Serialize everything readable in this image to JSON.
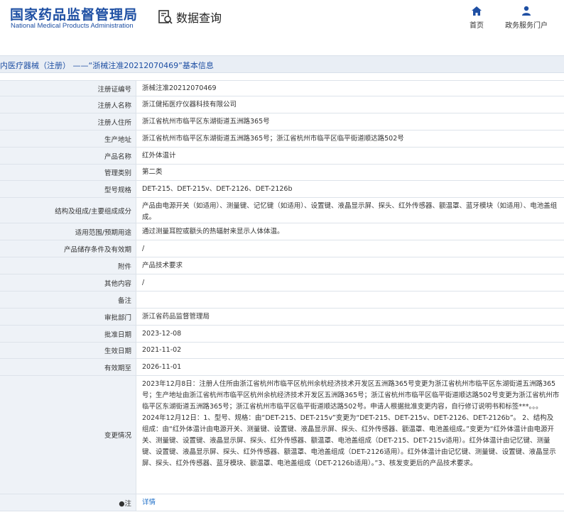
{
  "header": {
    "logo_cn": "国家药品监督管理局",
    "logo_en": "National Medical Products Administration",
    "data_query": "数据查询",
    "nav": [
      {
        "label": "首页",
        "icon": "home-icon"
      },
      {
        "label": "政务服务门户",
        "icon": "user-icon"
      }
    ],
    "accent_color": "#1e4fa3"
  },
  "title_bar": {
    "text": "内医疗器械（注册） ——“浙械注准20212070469”基本信息"
  },
  "rows": [
    {
      "label": "注册证编号",
      "value": "浙械注准20212070469"
    },
    {
      "label": "注册人名称",
      "value": "浙江健拓医疗仪器科技有限公司"
    },
    {
      "label": "注册人住所",
      "value": "浙江省杭州市临平区东湖街道五洲路365号"
    },
    {
      "label": "生产地址",
      "value": "浙江省杭州市临平区东湖街道五洲路365号；浙江省杭州市临平区临平街道顺达路502号"
    },
    {
      "label": "产品名称",
      "value": "红外体温计"
    },
    {
      "label": "管理类别",
      "value": "第二类"
    },
    {
      "label": "型号规格",
      "value": "DET-215、DET-215v、DET-2126、DET-2126b"
    },
    {
      "label": "结构及组成/主要组成成分",
      "value": "产品由电源开关（如适用）、测量键、记忆键（如适用）、设置键、液晶显示屏、探头、红外传感器、额温罩、蓝牙模块（如适用）、电池盖组成。"
    },
    {
      "label": "适用范围/预期用途",
      "value": "通过测量耳腔或额头的热辐射来显示人体体温。"
    },
    {
      "label": "产品储存条件及有效期",
      "value": "/"
    },
    {
      "label": "附件",
      "value": "产品技术要求"
    },
    {
      "label": "其他内容",
      "value": "/"
    },
    {
      "label": "备注",
      "value": ""
    },
    {
      "label": "审批部门",
      "value": "浙江省药品监督管理局"
    },
    {
      "label": "批准日期",
      "value": "2023-12-08"
    },
    {
      "label": "生效日期",
      "value": "2021-11-02"
    },
    {
      "label": "有效期至",
      "value": "2026-11-01"
    },
    {
      "label": "变更情况",
      "value": "2023年12月8日：注册人住所由浙江省杭州市临平区杭州余杭经济技术开发区五洲路365号变更为浙江省杭州市临平区东湖街道五洲路365号；生产地址由浙江省杭州市临平区杭州余杭经济技术开发区五洲路365号；浙江省杭州市临平区临平街道顺达路502号变更为浙江省杭州市临平区东湖街道五洲路365号；浙江省杭州市临平区临平街道顺达路502号。申请人根据批准变更内容，自行修订说明书和标签***。。。\n2024年12月12日：1、型号、规格：由“DET-215、DET-215v”变更为“DET-215、DET-215v、DET-2126、DET-2126b”。 2、结构及组成：由“红外体温计由电源开关、测量键、设置键、液晶显示屏、探头、红外传感器、额温罩、电池盖组成。”变更为“红外体温计由电源开关、测量键、设置键、液晶显示屏、探头、红外传感器、额温罩、电池盖组成（DET-215、DET-215v适用）。红外体温计由记忆键、测量键、设置键、液晶显示屏、探头、红外传感器、额温罩、电池盖组成（DET-2126适用）。红外体温计由记忆键、测量键、设置键、液晶显示屏、探头、红外传感器、蓝牙模块、额温罩、电池盖组成（DET-2126b适用）。”3、核发变更后的产品技术要求。"
    },
    {
      "label": "●注",
      "value": "详情",
      "is_link": true
    }
  ]
}
